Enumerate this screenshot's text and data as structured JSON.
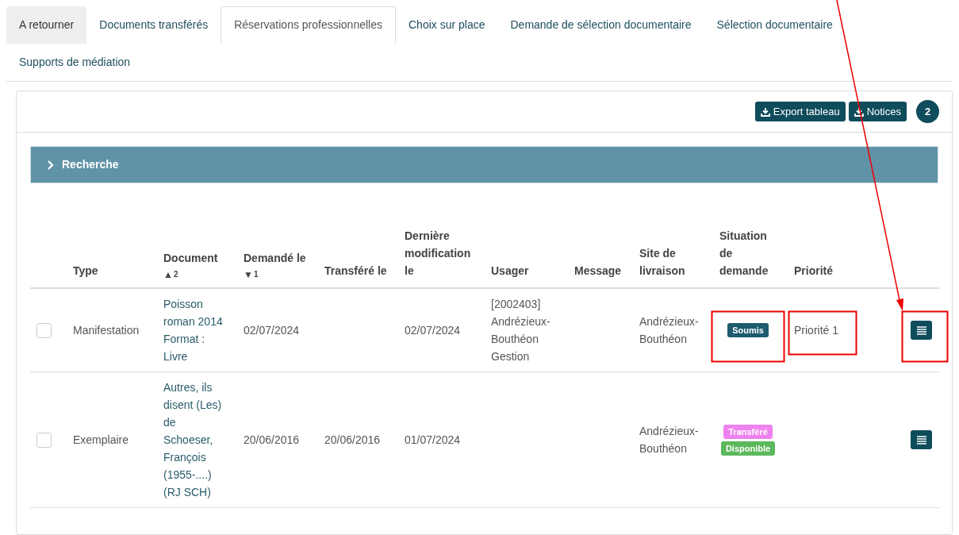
{
  "tabs": [
    {
      "label": "A retourner",
      "selected": false,
      "kind": "grey"
    },
    {
      "label": "Documents transférés",
      "selected": false,
      "kind": "plain"
    },
    {
      "label": "Réservations professionnelles",
      "selected": true,
      "kind": "plain"
    },
    {
      "label": "Choix sur place",
      "selected": false,
      "kind": "plain"
    },
    {
      "label": "Demande de sélection documentaire",
      "selected": false,
      "kind": "plain"
    },
    {
      "label": "Sélection documentaire",
      "selected": false,
      "kind": "plain"
    },
    {
      "label": "Supports de médiation",
      "selected": false,
      "kind": "plain"
    }
  ],
  "toolbar": {
    "buttons": [
      "Export tableau",
      "Notices"
    ],
    "count": "2"
  },
  "search_bar": {
    "label": "Recherche",
    "expanded": false
  },
  "table": {
    "columns": [
      {
        "label": "Type"
      },
      {
        "label": "Document",
        "sort": {
          "arrow": "▲",
          "rank": "2"
        }
      },
      {
        "label": "Demandé le",
        "sort": {
          "arrow": "▼",
          "rank": "1"
        }
      },
      {
        "label": "Transféré le"
      },
      {
        "label": "Dernière modification le"
      },
      {
        "label": "Usager"
      },
      {
        "label": "Message"
      },
      {
        "label": "Site de livraison"
      },
      {
        "label": "Situation de demande"
      },
      {
        "label": "Priorité"
      }
    ],
    "rows": [
      {
        "checked": false,
        "type": "Manifestation",
        "document": "Poisson roman 2014 Format : Livre",
        "requested": "02/07/2024",
        "transferred": "",
        "modified": "02/07/2024",
        "user": "[2002403] Andrézieux-Bouthéon Gestion",
        "message": "",
        "site": "Andrézieux-Bouthéon",
        "statuses": [
          {
            "label": "Soumis",
            "color": "#1d5b6e"
          }
        ],
        "priority": "Priorité 1",
        "highlighted": true
      },
      {
        "checked": false,
        "type": "Exemplaire",
        "document": "Autres, ils disent (Les) de Schoeser, François (1955-....) (RJ SCH)",
        "requested": "20/06/2016",
        "transferred": "20/06/2016",
        "modified": "01/07/2024",
        "user": "",
        "message": "",
        "site": "Andrézieux-Bouthéon",
        "statuses": [
          {
            "label": "Transféré",
            "color": "#ee82ee"
          },
          {
            "label": "Disponible",
            "color": "#5cb85c"
          }
        ],
        "priority": "",
        "highlighted": false
      }
    ]
  },
  "pointer_arrow": true
}
